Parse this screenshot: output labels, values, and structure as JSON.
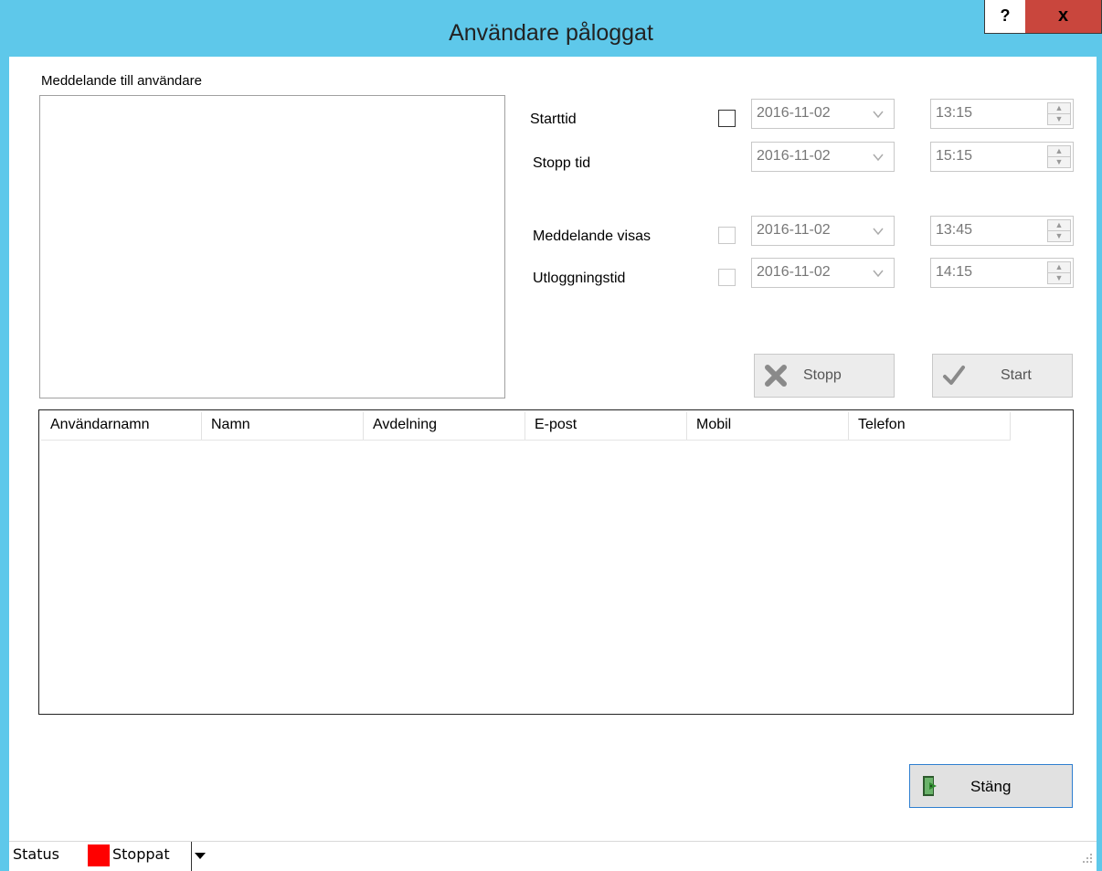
{
  "window": {
    "title": "Användare påloggat",
    "help_label": "?",
    "close_label": "x"
  },
  "message": {
    "label": "Meddelande till användare",
    "text": ""
  },
  "schedule": {
    "start": {
      "label": "Starttid",
      "date": "2016-11-02",
      "time": "13:15",
      "checked": false
    },
    "stop": {
      "label": "Stopp tid",
      "date": "2016-11-02",
      "time": "15:15"
    },
    "show": {
      "label": "Meddelande visas",
      "date": "2016-11-02",
      "time": "13:45",
      "checked": false
    },
    "logout": {
      "label": "Utloggningstid",
      "date": "2016-11-02",
      "time": "14:15",
      "checked": false
    }
  },
  "actions": {
    "stop_label": "Stopp",
    "start_label": "Start"
  },
  "grid": {
    "columns": [
      "Användarnamn",
      "Namn",
      "Avdelning",
      "E-post",
      "Mobil",
      "Telefon"
    ],
    "rows": []
  },
  "footer": {
    "close_label": "Stäng"
  },
  "statusbar": {
    "label": "Status",
    "value": "Stoppat",
    "indicator_color": "#ff0000"
  },
  "icons": {
    "stop": "x-icon",
    "start": "checkmark-icon",
    "close": "exit-door-icon",
    "dropdown": "chevron-down-icon",
    "spin": "spin-arrows-icon"
  }
}
